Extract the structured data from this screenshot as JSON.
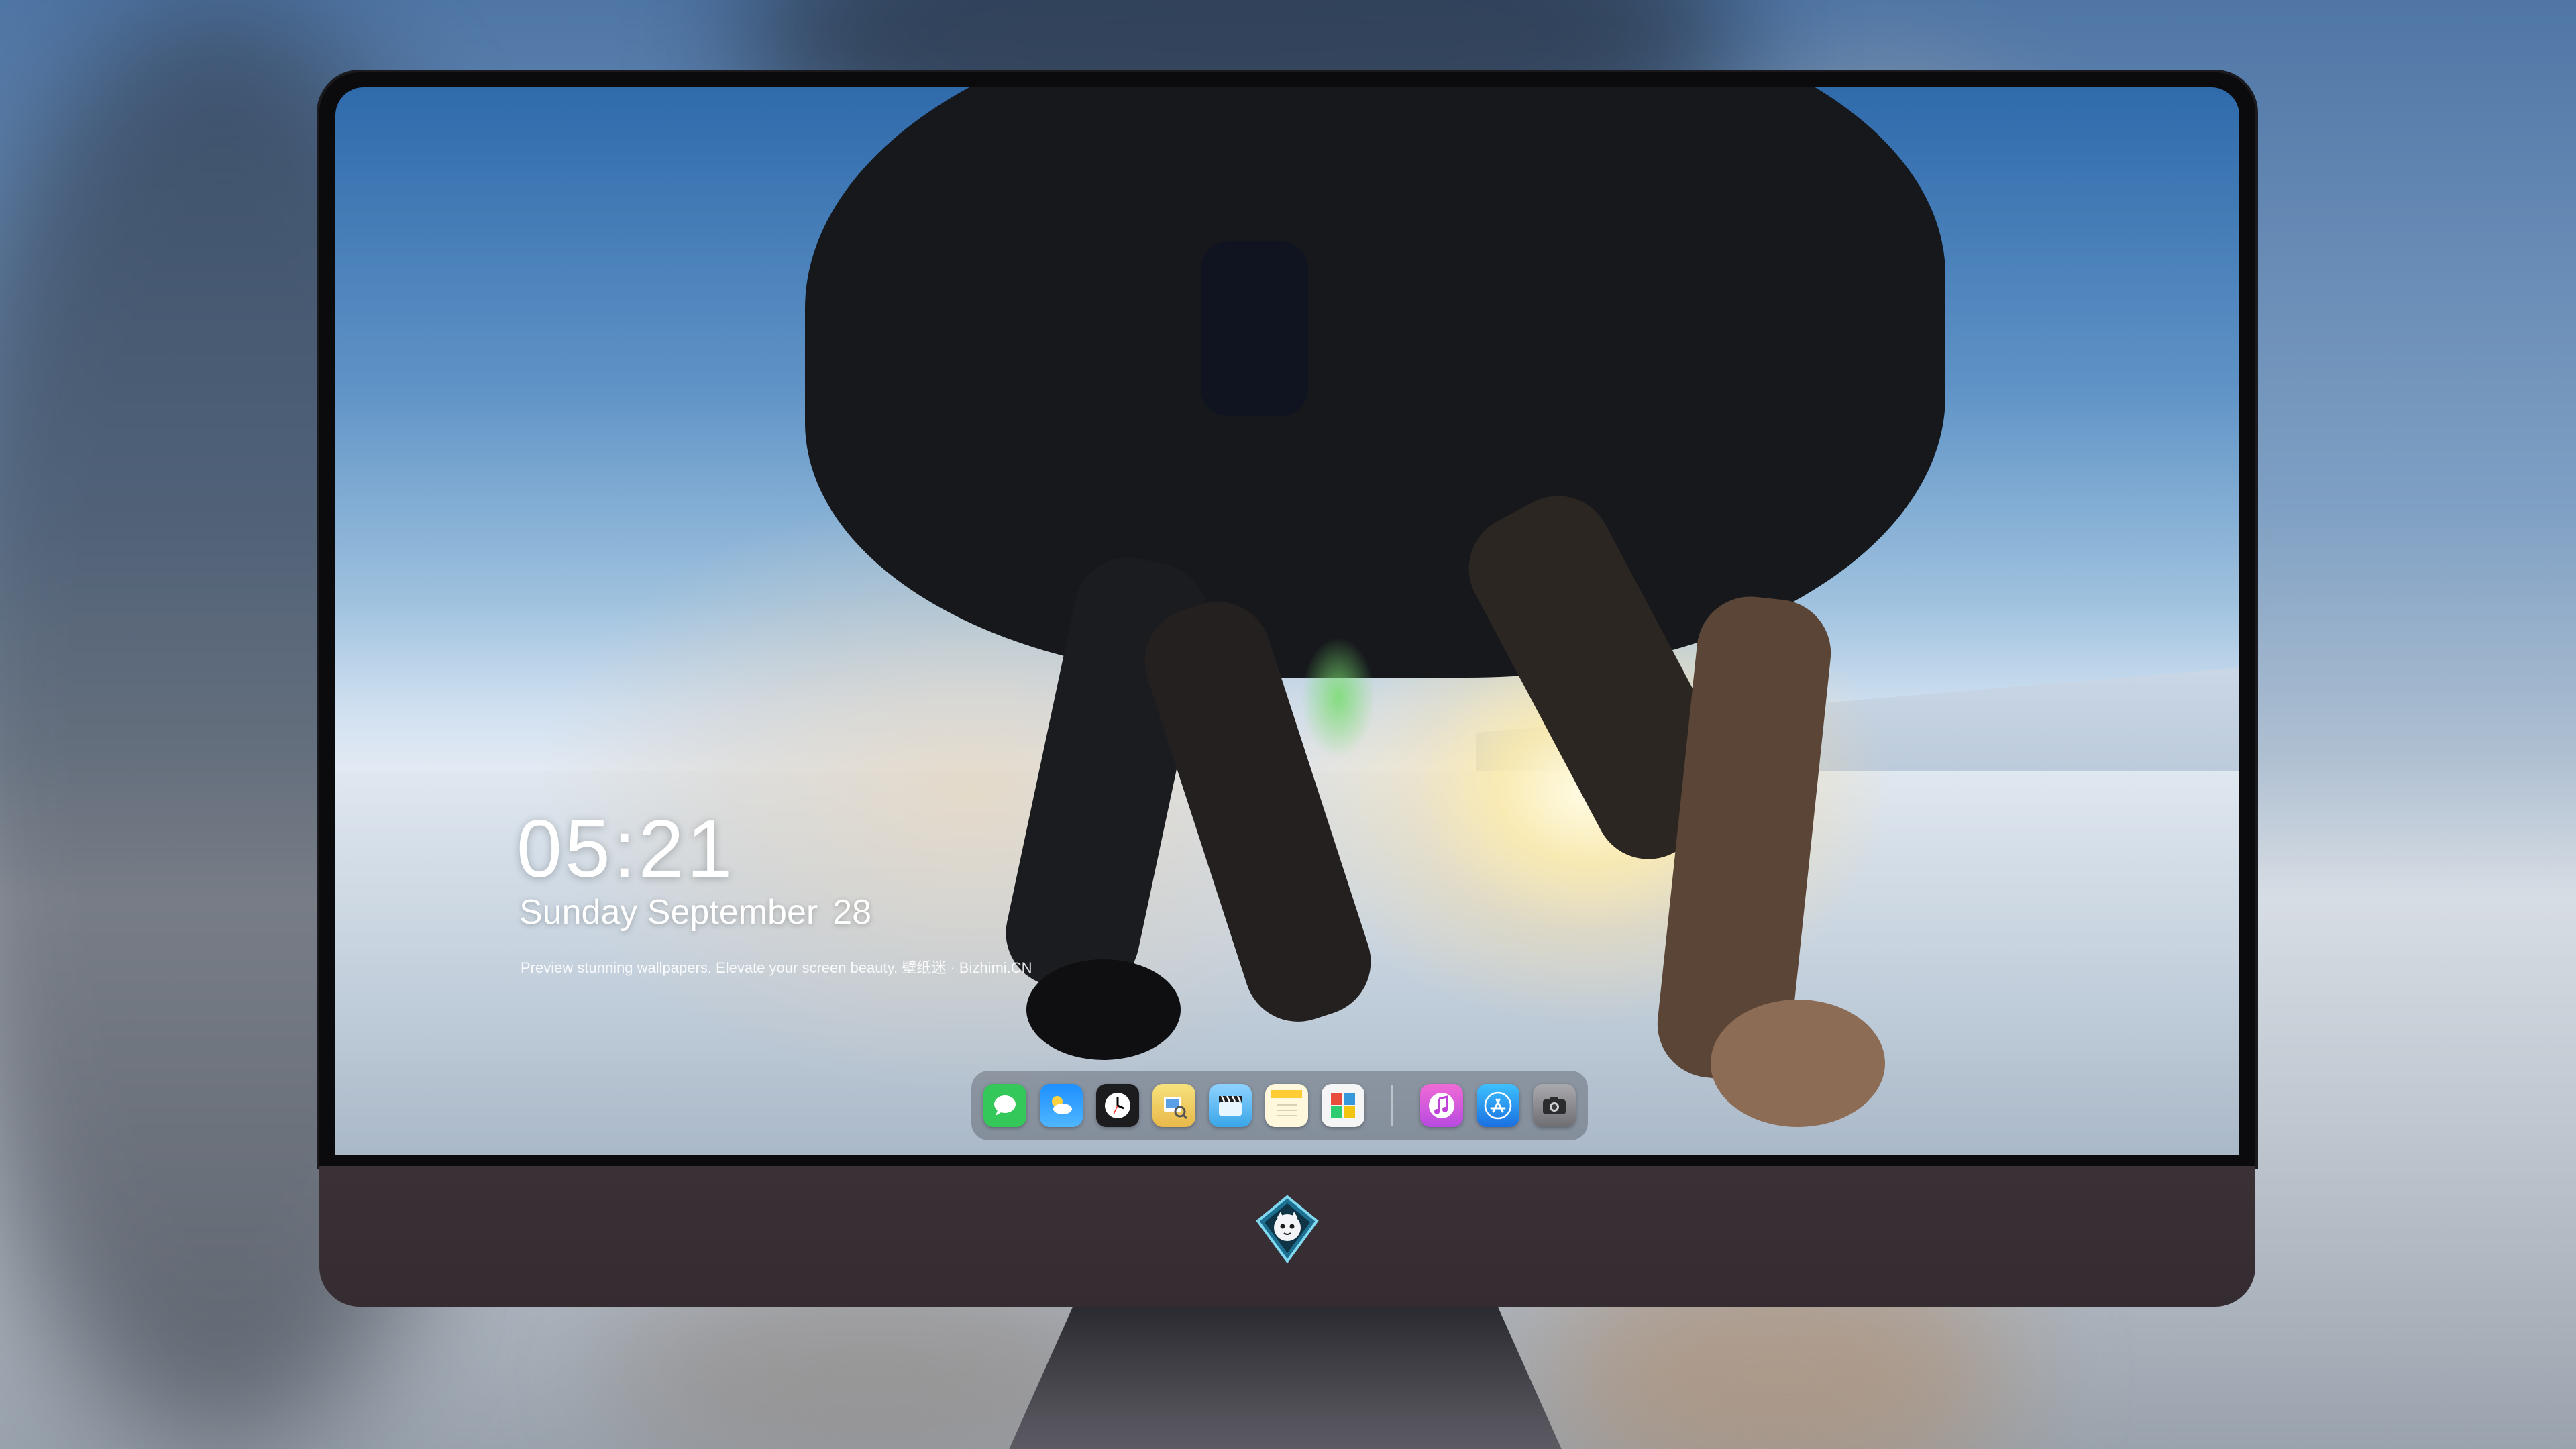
{
  "lock_screen": {
    "time": "05:21",
    "weekday_month": "Sunday September",
    "day": "28",
    "tagline": "Preview stunning wallpapers. Elevate your screen beauty. 壁纸迷 · Bizhimi.CN"
  },
  "dock": {
    "apps_group1": [
      {
        "icon": "messages-icon",
        "color": "#34c759"
      },
      {
        "icon": "weather-icon",
        "color": "#1e90ff"
      },
      {
        "icon": "clock-icon",
        "color": "#1c1c1e"
      },
      {
        "icon": "preview-icon",
        "color": "#f4d35e"
      },
      {
        "icon": "clips-icon",
        "color": "#5ac8fa"
      },
      {
        "icon": "notes-icon",
        "color": "#fbe38e"
      },
      {
        "icon": "photo-booth-icon",
        "color": "#e74c3c"
      }
    ],
    "apps_group2": [
      {
        "icon": "music-icon",
        "color": "#d74fd6"
      },
      {
        "icon": "app-store-icon",
        "color": "#1e88e5"
      },
      {
        "icon": "camera-icon",
        "color": "#8e8e93"
      }
    ]
  },
  "brand": {
    "icon": "bizhimi-mascot-logo-icon"
  },
  "colors": {
    "chin": "#352c32",
    "bezel": "#0b0b0d",
    "stand": "#55545c"
  }
}
